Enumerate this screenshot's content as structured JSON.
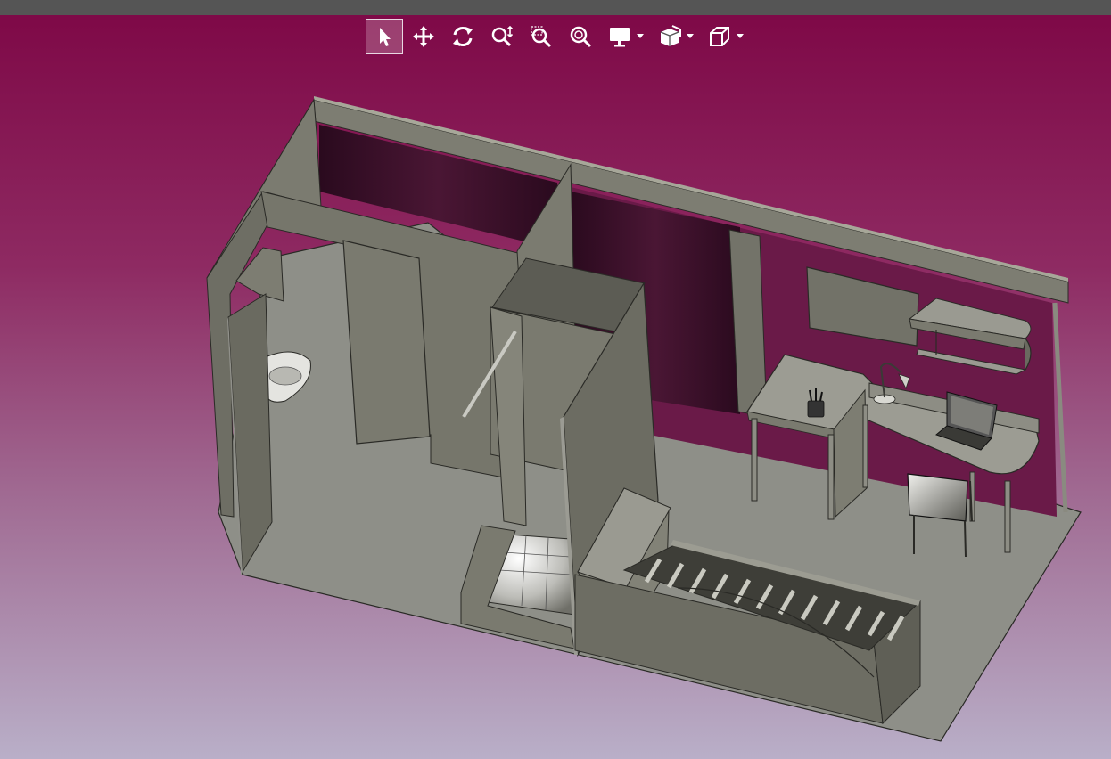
{
  "app": {
    "name": "3D model viewer"
  },
  "colors": {
    "topbar": "#555555",
    "background_top": "#7c0a48",
    "background_bottom": "#b9afc8",
    "model_wall": "#6e6e64",
    "model_floor": "#8e8f88",
    "toolbar_icon": "#ffffff"
  },
  "toolbar": {
    "tools": [
      {
        "icon": "select-arrow-icon",
        "active": true
      },
      {
        "icon": "pan-move-icon",
        "active": false
      },
      {
        "icon": "rotate-icon",
        "active": false
      },
      {
        "icon": "zoom-vertical-icon",
        "active": false
      },
      {
        "icon": "zoom-window-icon",
        "active": false
      },
      {
        "icon": "zoom-fit-icon",
        "active": false
      },
      {
        "icon": "display-monitor-icon",
        "active": false,
        "dropdown": true
      },
      {
        "icon": "clipping-plane-icon",
        "active": false,
        "dropdown": true
      },
      {
        "icon": "view-cube-icon",
        "active": false,
        "dropdown": true
      }
    ]
  },
  "scene": {
    "model": "dorm-room-floorplan-3d",
    "objects": [
      "walls",
      "door",
      "washbasin",
      "shower",
      "bed",
      "desk",
      "lamp",
      "laptop",
      "pencil-cup",
      "chair",
      "wall-shelf",
      "pinboard"
    ]
  }
}
